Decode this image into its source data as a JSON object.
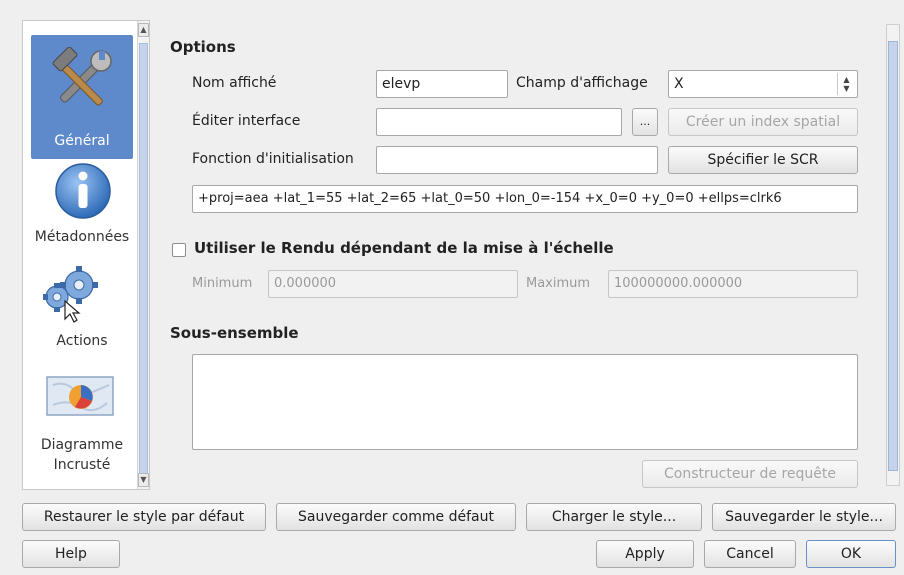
{
  "sidebar": {
    "items": [
      {
        "label": "Général",
        "icon": "tools-icon",
        "selected": true
      },
      {
        "label": "Métadonnées",
        "icon": "info-icon",
        "selected": false
      },
      {
        "label": "Actions",
        "icon": "gears-icon",
        "selected": false
      },
      {
        "label": "Diagramme",
        "label2": "Incrusté",
        "icon": "chart-map-icon",
        "selected": false
      }
    ]
  },
  "options": {
    "title": "Options",
    "display_name_label": "Nom affiché",
    "display_name_value": "elevp",
    "display_field_label": "Champ d'affichage",
    "display_field_value": "X",
    "edit_ui_label": "Éditer interface",
    "edit_ui_value": "",
    "browse_label": "...",
    "spatial_index_label": "Créer un index spatial",
    "init_func_label": "Fonction d'initialisation",
    "init_func_value": "",
    "crs_button_label": "Spécifier le SCR",
    "crs_string": "+proj=aea +lat_1=55 +lat_2=65 +lat_0=50 +lon_0=-154 +x_0=0 +y_0=0 +ellps=clrk6"
  },
  "scale": {
    "checkbox_label": "Utiliser le Rendu dépendant de la mise à l'échelle",
    "checked": false,
    "min_label": "Minimum",
    "min_value": "0.000000",
    "max_label": "Maximum",
    "max_value": "100000000.000000"
  },
  "subset": {
    "title": "Sous-ensemble",
    "value": "",
    "query_builder_label": "Constructeur de requête"
  },
  "bottom": {
    "restore_label": "Restaurer le style par défaut",
    "save_default_label": "Sauvegarder comme défaut",
    "load_style_label": "Charger le style...",
    "save_style_label": "Sauvegarder le style...",
    "help_label": "Help",
    "apply_label": "Apply",
    "cancel_label": "Cancel",
    "ok_label": "OK"
  },
  "colors": {
    "selection": "#5e8acb",
    "background": "#efefef"
  }
}
